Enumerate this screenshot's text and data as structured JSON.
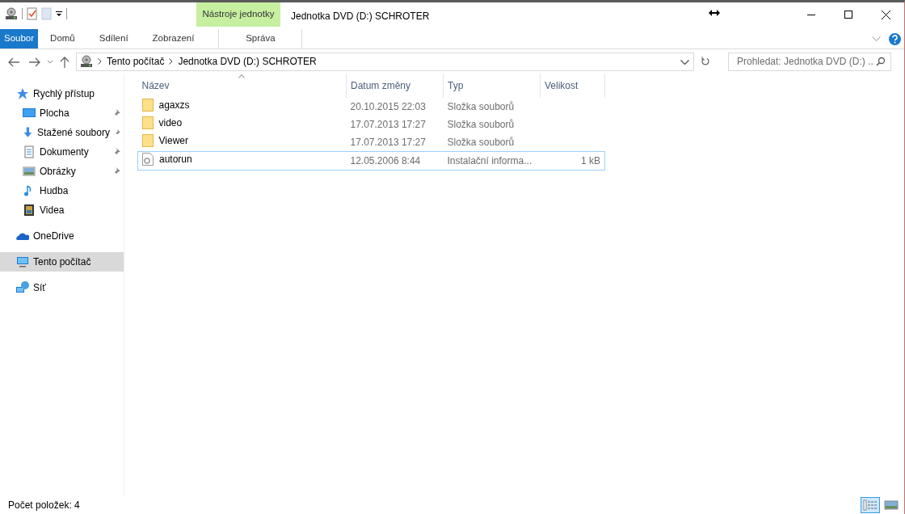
{
  "window": {
    "title": "Jednotka DVD (D:) SCHROTER",
    "context_group": "Nástroje jednotky"
  },
  "ribbon_tabs": [
    {
      "label": "Soubor",
      "kind": "file"
    },
    {
      "label": "Domů",
      "kind": "tab"
    },
    {
      "label": "Sdílení",
      "kind": "tab"
    },
    {
      "label": "Zobrazení",
      "kind": "tab"
    },
    {
      "label": "Správa",
      "kind": "contextual"
    }
  ],
  "address_bar": {
    "breadcrumbs": [
      "Tento počítač",
      "Jednotka DVD (D:) SCHROTER"
    ]
  },
  "search": {
    "placeholder": "Prohledat: Jednotka DVD (D:) ..."
  },
  "sidebar": {
    "items": [
      {
        "label": "Rychlý přístup",
        "kind": "star",
        "selected": false,
        "children": [
          {
            "label": "Plocha",
            "kind": "desktop",
            "pinned": true,
            "selected": false
          },
          {
            "label": "Stažené soubory",
            "kind": "download",
            "pinned": true,
            "selected": false
          },
          {
            "label": "Dokumenty",
            "kind": "document",
            "pinned": true,
            "selected": false
          },
          {
            "label": "Obrázky",
            "kind": "picture",
            "pinned": true,
            "selected": false
          },
          {
            "label": "Hudba",
            "kind": "music",
            "pinned": false,
            "selected": false
          },
          {
            "label": "Videa",
            "kind": "film",
            "pinned": false,
            "selected": false
          }
        ]
      },
      {
        "label": "OneDrive",
        "kind": "cloud",
        "selected": false
      },
      {
        "label": "Tento počítač",
        "kind": "computer",
        "selected": true
      },
      {
        "label": "Síť",
        "kind": "network",
        "selected": false
      }
    ]
  },
  "table": {
    "columns": [
      {
        "label": "Název",
        "sorted": true
      },
      {
        "label": "Datum změny",
        "sorted": false
      },
      {
        "label": "Typ",
        "sorted": false
      },
      {
        "label": "Velikost",
        "sorted": false
      }
    ],
    "rows": [
      {
        "kind": "folder",
        "focused": false,
        "name": "agaxzs",
        "date": "20.10.2015 22:03",
        "type": "Složka souborů"
      },
      {
        "kind": "folder",
        "focused": false,
        "name": "video",
        "date": "17.07.2013 17:27",
        "type": "Složka souborů"
      },
      {
        "kind": "folder",
        "focused": false,
        "name": "Viewer",
        "date": "17.07.2013 17:27",
        "type": "Složka souborů"
      },
      {
        "kind": "file",
        "focused": true,
        "name": "autorun",
        "date": "12.05.2006 8:44",
        "type": "Instalační informa...",
        "size": "1 kB"
      }
    ]
  },
  "status_bar": {
    "text": "Počet položek: 4",
    "views": [
      {
        "kind": "details",
        "selected": true
      },
      {
        "kind": "thumbnails",
        "selected": false
      }
    ]
  }
}
